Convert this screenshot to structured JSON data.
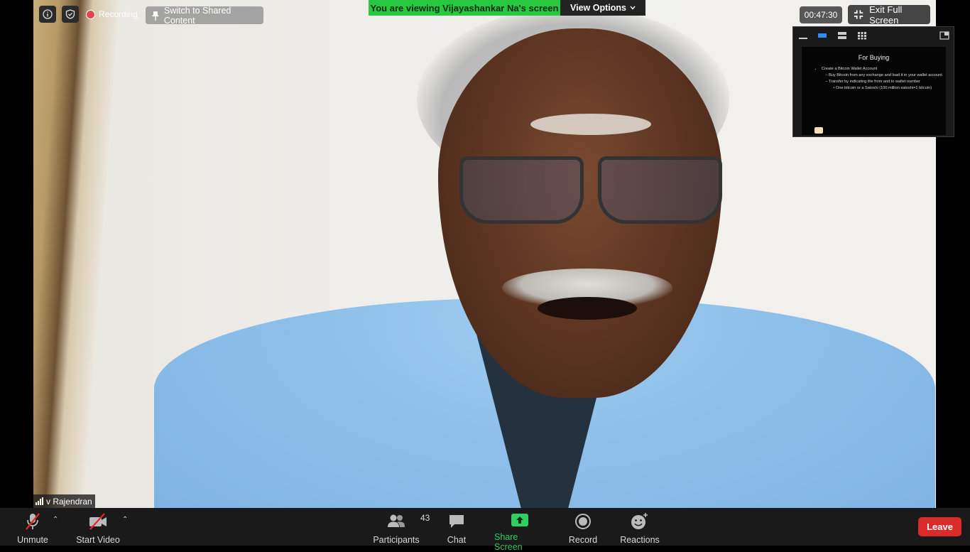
{
  "top_left": {
    "recording_label": "Recording",
    "switch_label": "Switch to Shared Content"
  },
  "banner": {
    "viewing_text": "You are viewing Vijayashankar Na's screen",
    "view_options_label": "View Options"
  },
  "top_right": {
    "timer": "00:47:30",
    "exit_fullscreen_label": "Exit Full Screen"
  },
  "shared_slide": {
    "title": "For Buying",
    "bullets": [
      {
        "text": "Create a Bitcoin Wallet Account",
        "sub": [
          {
            "text": "Buy Bitcoin from any exchange and load it in your wallet account"
          },
          {
            "text": "Transfer by indicating the from and to wallet number",
            "sub": [
              {
                "text": "One bitcoin or a Satoshi (100 million satoshi=1 bitcoin)"
              }
            ]
          }
        ]
      }
    ]
  },
  "participant": {
    "name": "v Rajendran"
  },
  "toolbar": {
    "unmute_label": "Unmute",
    "start_video_label": "Start Video",
    "participants_label": "Participants",
    "participants_count": "43",
    "chat_label": "Chat",
    "share_screen_label": "Share Screen",
    "record_label": "Record",
    "reactions_label": "Reactions",
    "leave_label": "Leave"
  },
  "colors": {
    "banner_green": "#28c840",
    "share_green": "#2fd061",
    "leave_red": "#d92b2b",
    "toolbar_bg": "#1a1a1a",
    "thumb_active_blue": "#2d8cff"
  }
}
